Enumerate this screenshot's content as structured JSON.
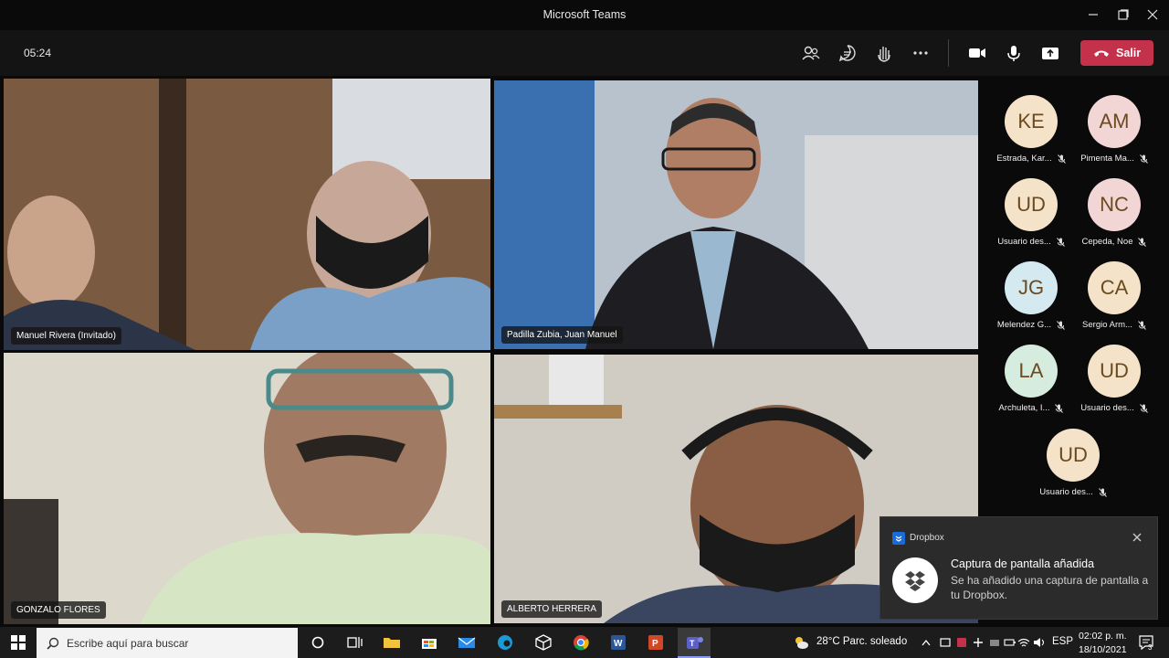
{
  "window": {
    "title": "Microsoft Teams"
  },
  "toolbar": {
    "timer": "05:24",
    "leave_label": "Salir"
  },
  "tiles": [
    {
      "name": "Manuel Rivera (Invitado)"
    },
    {
      "name": "Padilla Zubia, Juan Manuel"
    },
    {
      "name": "GONZALO FLORES"
    },
    {
      "name": "ALBERTO HERRERA"
    }
  ],
  "participants": [
    {
      "initials": "KE",
      "name": "Estrada, Kar...",
      "color": "#f4e3c8"
    },
    {
      "initials": "AM",
      "name": "Pimenta Ma...",
      "color": "#f2d6d6"
    },
    {
      "initials": "UD",
      "name": "Usuario des...",
      "color": "#f4e3c8"
    },
    {
      "initials": "NC",
      "name": "Cepeda, Noe",
      "color": "#f2d6d6"
    },
    {
      "initials": "JG",
      "name": "Melendez G...",
      "color": "#d4eaf0"
    },
    {
      "initials": "CA",
      "name": "Sergio Arm...",
      "color": "#f4e3c8"
    },
    {
      "initials": "LA",
      "name": "Archuleta, I...",
      "color": "#d6ecdf"
    },
    {
      "initials": "UD",
      "name": "Usuario des...",
      "color": "#f4e3c8"
    },
    {
      "initials": "UD",
      "name": "Usuario des...",
      "color": "#f4e3c8"
    }
  ],
  "toast": {
    "app": "Dropbox",
    "title": "Captura de pantalla añadida",
    "message": "Se ha añadido una captura de pantalla a tu Dropbox."
  },
  "taskbar": {
    "search_placeholder": "Escribe aquí para buscar",
    "weather": "28°C  Parc. soleado",
    "lang": "ESP",
    "time": "02:02 p. m.",
    "date": "18/10/2021",
    "notifications": "3"
  }
}
